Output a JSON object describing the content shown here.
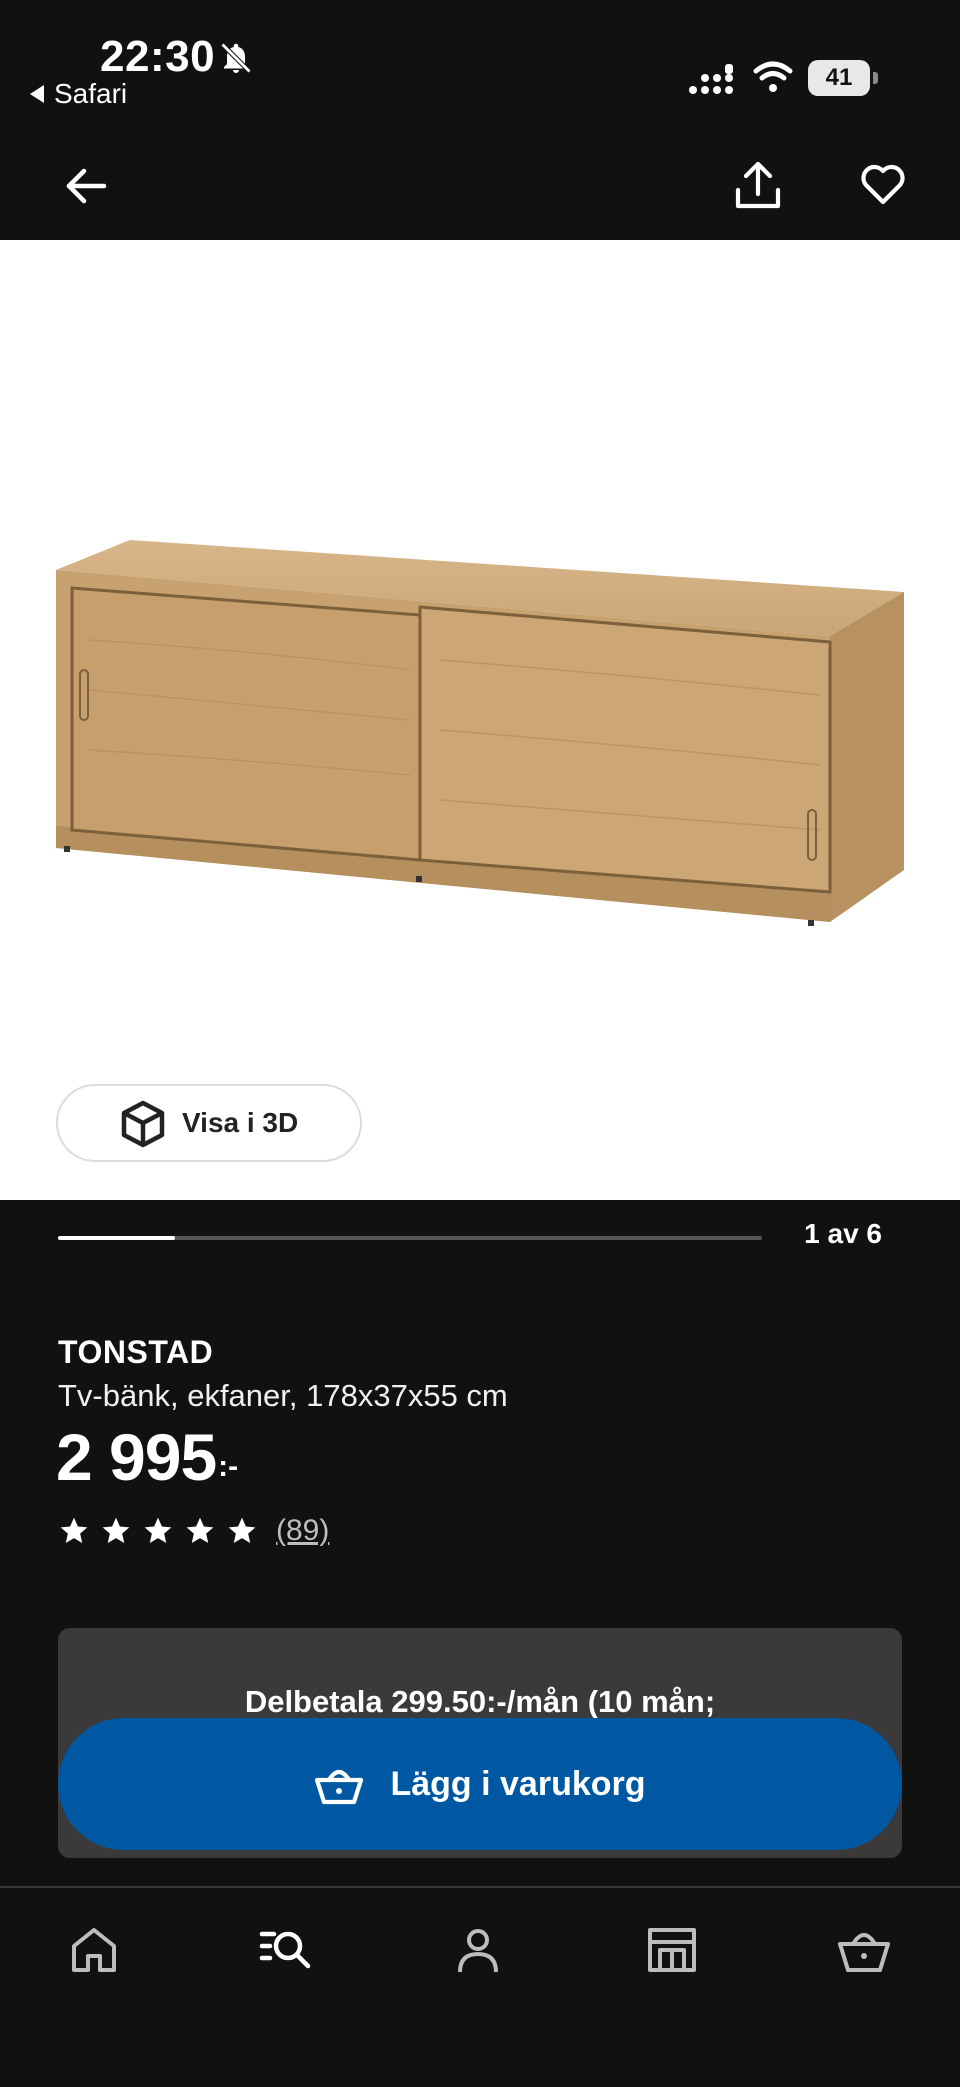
{
  "status_bar": {
    "time": "22:30",
    "back_app": "Safari",
    "battery": "41"
  },
  "header": {
    "icons": [
      "back-arrow-icon",
      "share-icon",
      "heart-icon"
    ]
  },
  "gallery": {
    "view_3d_label": "Visa i 3D",
    "page_indicator": "1 av 6",
    "current_image": 1,
    "total_images": 6
  },
  "product": {
    "name": "TONSTAD",
    "description": "Tv-bänk, ekfaner, 178x37x55 cm",
    "price": "2 995",
    "price_suffix": ":-",
    "rating_stars": 5,
    "review_count": "(89)"
  },
  "purchase": {
    "installment_text": "Delbetala 299.50:-/mån (10 mån;",
    "add_to_cart_label": "Lägg i varukorg"
  },
  "bottom_nav": {
    "items": [
      "home-icon",
      "search-icon",
      "profile-icon",
      "store-icon",
      "cart-icon"
    ]
  },
  "colors": {
    "background": "#111111",
    "primary_blue": "#0058a3",
    "card_gray": "#3a3a3a",
    "image_bg": "#ffffff"
  }
}
